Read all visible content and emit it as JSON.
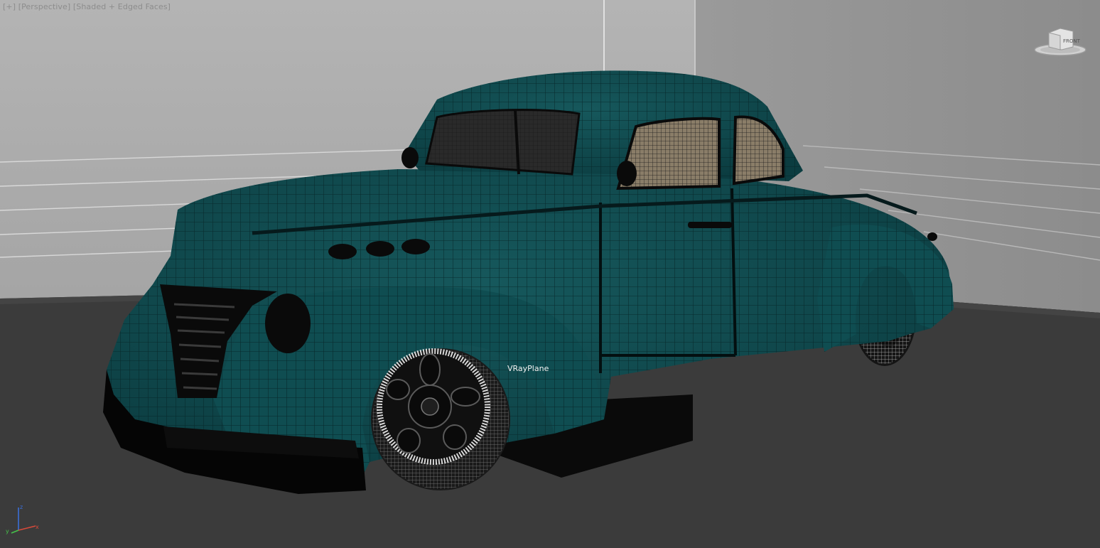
{
  "viewport": {
    "label": "[+] [Perspective] [Shaded + Edged Faces]",
    "object_label": "VRayPlane",
    "view_cube_label": "FRONT",
    "axes": {
      "x": "x",
      "y": "y",
      "z": "z"
    }
  },
  "colors": {
    "car_body": "#0e4a4e",
    "car_body_light": "#15595d",
    "wire": "#062426",
    "back_wall": "#a9a9a9",
    "floor": "#3a3a3a"
  }
}
